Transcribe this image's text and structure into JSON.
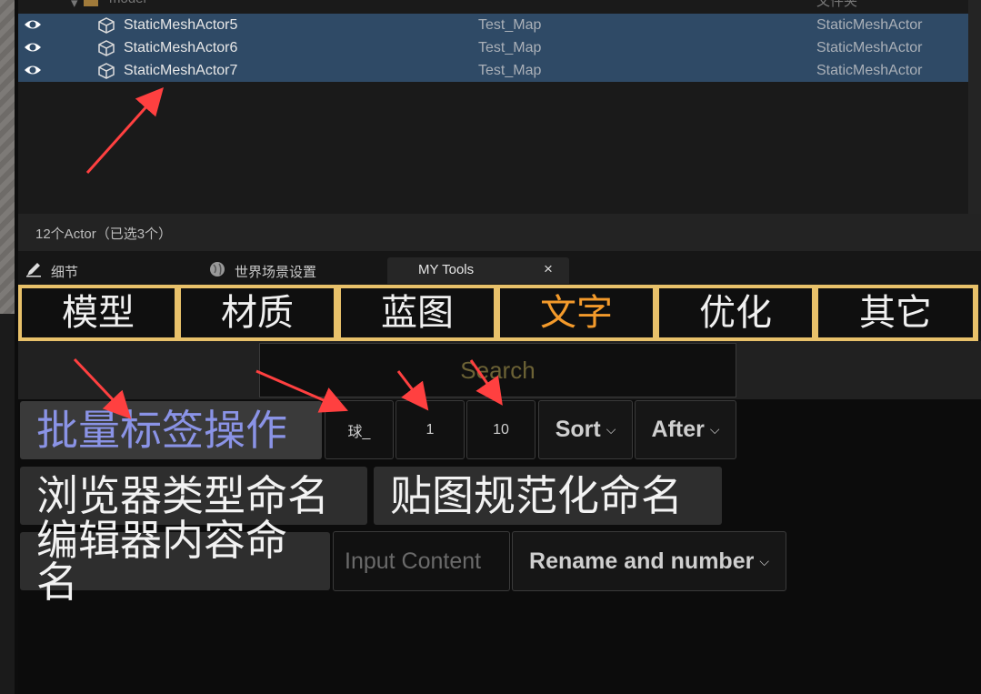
{
  "outliner": {
    "top_row": {
      "name": "model",
      "type": "文件夹"
    },
    "rows": [
      {
        "name": "StaticMeshActor5",
        "map": "Test_Map",
        "type": "StaticMeshActor"
      },
      {
        "name": "StaticMeshActor6",
        "map": "Test_Map",
        "type": "StaticMeshActor"
      },
      {
        "name": "StaticMeshActor7",
        "map": "Test_Map",
        "type": "StaticMeshActor"
      }
    ],
    "status": "12个Actor（已选3个）"
  },
  "tabs": [
    {
      "label": "细节",
      "icon": "pencil-icon"
    },
    {
      "label": "世界场景设置",
      "icon": "globe-icon"
    },
    {
      "label": "MY Tools",
      "close": "×"
    }
  ],
  "categories": [
    "模型",
    "材质",
    "蓝图",
    "文字",
    "优化",
    "其它"
  ],
  "active_category": "文字",
  "search": {
    "placeholder": "Search"
  },
  "batch": {
    "label": "批量标签操作",
    "prefix": "球_",
    "start": "1",
    "count": "10",
    "sort": "Sort",
    "position": "After"
  },
  "browser_rename": "浏览器类型命名",
  "texture_rename": "贴图规范化命名",
  "editor_rename": {
    "label": "编辑器内容命名",
    "placeholder": "Input Content",
    "mode": "Rename and number"
  },
  "colors": {
    "selection": "#2f4a66",
    "accent": "#f39a2b",
    "border": "#e8c16a",
    "annotation": "#ff4040"
  }
}
